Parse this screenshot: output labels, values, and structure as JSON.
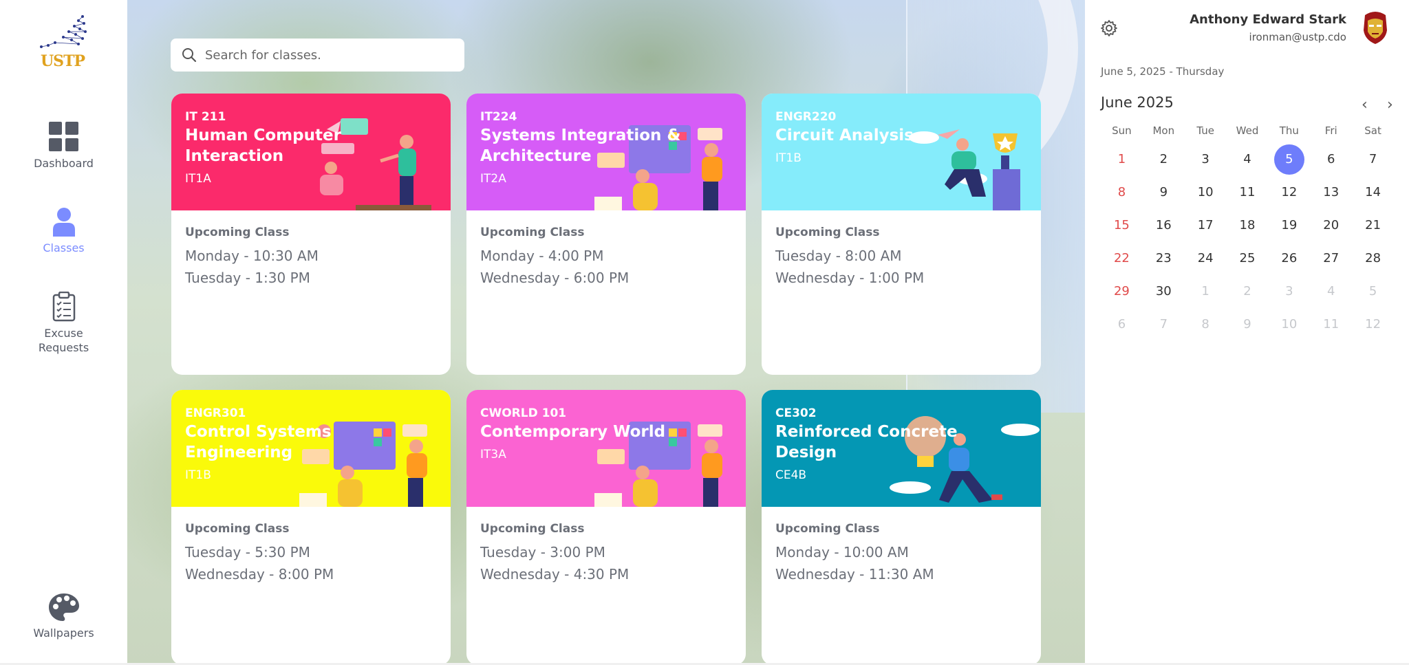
{
  "sidebar": {
    "logo_text": "USTP",
    "items": [
      {
        "label": "Dashboard",
        "icon": "dashboard-icon"
      },
      {
        "label": "Classes",
        "icon": "user-icon"
      },
      {
        "label": "Excuse Requests",
        "icon": "clipboard-icon"
      },
      {
        "label": "Wallpapers",
        "icon": "palette-icon"
      }
    ]
  },
  "search": {
    "placeholder": "Search for classes."
  },
  "classes": [
    {
      "code": "IT 211",
      "title": "Human Computer Interaction",
      "section": "IT1A",
      "color": "#fb2a6b",
      "upcoming_label": "Upcoming Class",
      "schedule": [
        "Monday - 10:30 AM",
        "Tuesday - 1:30 PM"
      ]
    },
    {
      "code": "IT224",
      "title": "Systems Integration & Architecture",
      "section": "IT2A",
      "color": "#d65cf7",
      "upcoming_label": "Upcoming Class",
      "schedule": [
        "Monday - 4:00 PM",
        "Wednesday - 6:00 PM"
      ]
    },
    {
      "code": "ENGR220",
      "title": "Circuit Analysis",
      "section": "IT1B",
      "color": "#85ecfb",
      "upcoming_label": "Upcoming Class",
      "schedule": [
        "Tuesday - 8:00 AM",
        "Wednesday - 1:00 PM"
      ]
    },
    {
      "code": "ENGR301",
      "title": "Control Systems Engineering",
      "section": "IT1B",
      "color": "#fafa0a",
      "upcoming_label": "Upcoming Class",
      "schedule": [
        "Tuesday - 5:30 PM",
        "Wednesday - 8:00 PM"
      ]
    },
    {
      "code": "CWORLD 101",
      "title": "Contemporary World",
      "section": "IT3A",
      "color": "#fb63d2",
      "upcoming_label": "Upcoming Class",
      "schedule": [
        "Tuesday - 3:00 PM",
        "Wednesday - 4:30 PM"
      ]
    },
    {
      "code": "CE302",
      "title": "Reinforced Concrete Design",
      "section": "CE4B",
      "color": "#0497b4",
      "upcoming_label": "Upcoming Class",
      "schedule": [
        "Monday - 10:00 AM",
        "Wednesday - 11:30 AM"
      ]
    }
  ],
  "user": {
    "name": "Anthony Edward Stark",
    "email": "ironman@ustp.cdo"
  },
  "calendar": {
    "today_line": "June 5, 2025 - Thursday",
    "month_title": "June 2025",
    "prev_symbol": "‹",
    "next_symbol": "›",
    "weekdays": [
      "Sun",
      "Mon",
      "Tue",
      "Wed",
      "Thu",
      "Fri",
      "Sat"
    ],
    "weeks": [
      [
        "1",
        "2",
        "3",
        "4",
        "5",
        "6",
        "7"
      ],
      [
        "8",
        "9",
        "10",
        "11",
        "12",
        "13",
        "14"
      ],
      [
        "15",
        "16",
        "17",
        "18",
        "19",
        "20",
        "21"
      ],
      [
        "22",
        "23",
        "24",
        "25",
        "26",
        "27",
        "28"
      ],
      [
        "29",
        "30",
        "1",
        "2",
        "3",
        "4",
        "5"
      ],
      [
        "6",
        "7",
        "8",
        "9",
        "10",
        "11",
        "12"
      ]
    ],
    "selected_day": "5",
    "accent": "#6e7dfb",
    "weekend_color": "#e04a4a"
  }
}
